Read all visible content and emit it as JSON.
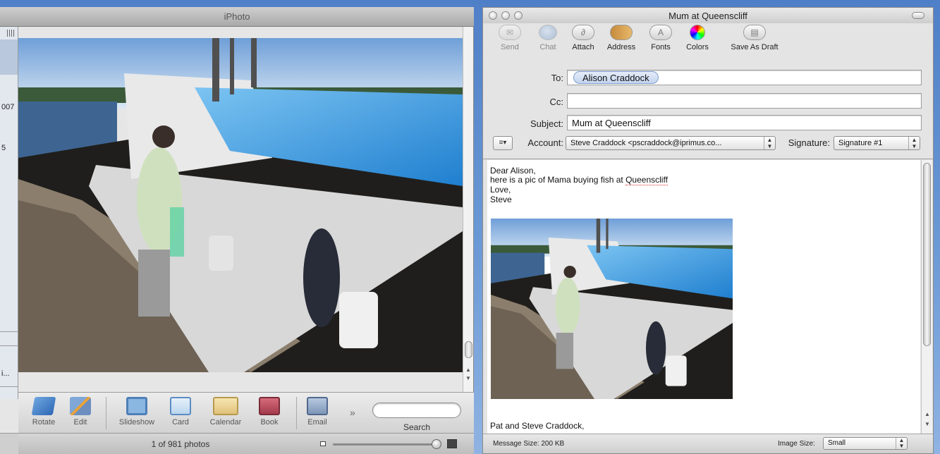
{
  "iphoto": {
    "title": "iPhoto",
    "sidebar_fragments": [
      "007",
      "5",
      "i...",
      "..."
    ],
    "toolbar": [
      {
        "label": "Rotate",
        "icon": "rotate-icon"
      },
      {
        "label": "Edit",
        "icon": "edit-icon"
      },
      {
        "label": "Slideshow",
        "icon": "slideshow-icon"
      },
      {
        "label": "Card",
        "icon": "card-icon"
      },
      {
        "label": "Calendar",
        "icon": "calendar-icon"
      },
      {
        "label": "Book",
        "icon": "book-icon"
      },
      {
        "label": "Email",
        "icon": "email-icon"
      }
    ],
    "more_glyph": "»",
    "search_label": "Search",
    "search_value": "",
    "photo_count": "1 of 981 photos"
  },
  "mail": {
    "window_title": "Mum at Queenscliff",
    "toolbar": [
      {
        "label": "Send",
        "icon": "send-icon",
        "enabled": false
      },
      {
        "label": "Chat",
        "icon": "chat-icon",
        "enabled": false
      },
      {
        "label": "Attach",
        "icon": "paperclip-icon",
        "enabled": true
      },
      {
        "label": "Address",
        "icon": "address-book-icon",
        "enabled": true
      },
      {
        "label": "Fonts",
        "icon": "fonts-icon",
        "enabled": true
      },
      {
        "label": "Colors",
        "icon": "color-wheel-icon",
        "enabled": true
      },
      {
        "label": "Save As Draft",
        "icon": "draft-icon",
        "enabled": true
      }
    ],
    "to_label": "To:",
    "to_recipient": "Alison Craddock",
    "cc_label": "Cc:",
    "cc_value": "",
    "subject_label": "Subject:",
    "subject_value": "Mum at Queenscliff",
    "account_label": "Account:",
    "account_value": "Steve Craddock <pscraddock@iprimus.co...",
    "signature_label": "Signature:",
    "signature_value": "Signature #1",
    "body_lines": [
      "Dear Alison,",
      "here is a pic of Mama buying fish at ",
      "Love,",
      "Steve"
    ],
    "body_misspelled_word": "Queenscliff",
    "signature_line": "Pat and Steve Craddock,",
    "message_size": "Message Size: 200 KB",
    "image_size_label": "Image Size:",
    "image_size_value": "Small"
  }
}
